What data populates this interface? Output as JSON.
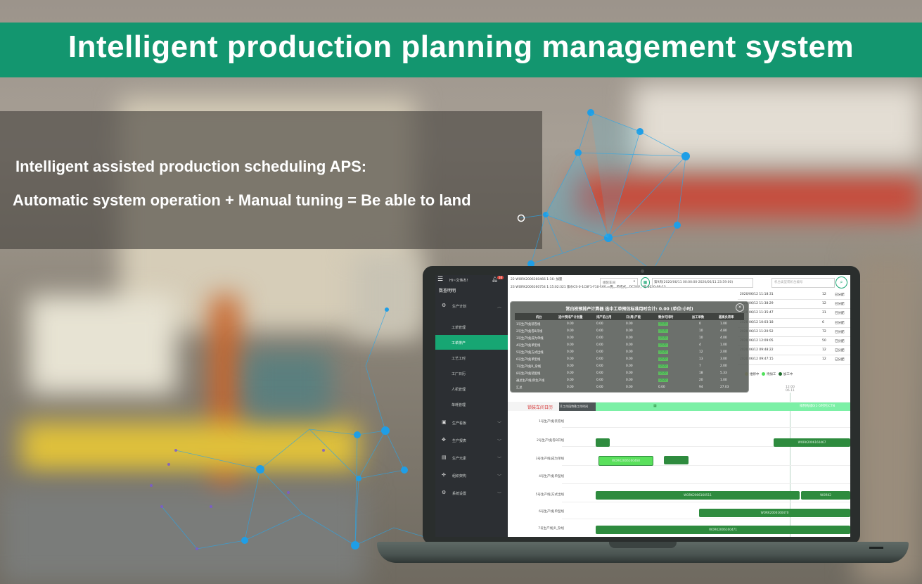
{
  "banner": {
    "title": "Intelligent production planning management system"
  },
  "caption": {
    "line1": "Intelligent assisted production scheduling APS:",
    "line2": "Automatic system operation + Manual tuning = Be able to land"
  },
  "colors": {
    "brand_green": "#13966f",
    "active_green": "#17a673",
    "bar_green": "#2e8b3e",
    "alert_red": "#d63b3b"
  },
  "app": {
    "sidebar": {
      "menu_icon": "menu-collapse-icon",
      "greeting": "Hi~文伟杰!",
      "badge": "16",
      "user": "数查明明",
      "items": [
        {
          "label": "生产计划",
          "icon": "plan-icon",
          "expanded": true
        },
        {
          "label": "生产看板",
          "icon": "board-icon"
        },
        {
          "label": "生产报表",
          "icon": "report-icon"
        },
        {
          "label": "生产元素",
          "icon": "element-icon"
        },
        {
          "label": "组织架构",
          "icon": "org-icon"
        },
        {
          "label": "系统设置",
          "icon": "settings-icon"
        }
      ],
      "subitems": [
        {
          "label": "工单管理",
          "active": false
        },
        {
          "label": "工单排产",
          "active": true
        },
        {
          "label": "工艺工时",
          "active": false
        },
        {
          "label": "工厂日历",
          "active": false
        },
        {
          "label": "人机管理",
          "active": false
        },
        {
          "label": "单耗管理",
          "active": false
        }
      ]
    },
    "topbar": {
      "row1": "22  WORK2006160466  1:16:  加量",
      "row2": "23  WORK2006160754  1:15:02:321     紫巾CS-0-1C8F1-F10-160 一覧，不成式，DC24V，等     2020-06-13",
      "select": "组装车间",
      "range": "第9周(2020/06/11 00:00:00-2020/06/11 23:59:00)",
      "search_placeholder": "机台类型或机台编号",
      "search_icon": "search-icon",
      "calendar_icon": "calendar-icon"
    },
    "right_table": [
      {
        "time": "2020/06/12 11:18:31",
        "qty": "12",
        "status": "已分配"
      },
      {
        "time": "2020/06/12 11:38:29",
        "qty": "12",
        "status": "已分配"
      },
      {
        "time": "2020/06/12 11:35:47",
        "qty": "31",
        "status": "已分配"
      },
      {
        "time": "2020/06/12 10:03:18",
        "qty": "6",
        "status": "已分配"
      },
      {
        "time": "2020/06/12 11:20:52",
        "qty": "72",
        "status": "已分配"
      },
      {
        "time": "2020/06/12 12:09:05",
        "qty": "50",
        "status": "已分配"
      },
      {
        "time": "2020/06/12 09:48:22",
        "qty": "12",
        "status": "已分配"
      },
      {
        "time": "2020/06/12 09:47:15",
        "qty": "12",
        "status": "已分配"
      }
    ],
    "popup": {
      "title": "常白校预排产计算器 选中工单预估标准用时合计: 0.00 (单位:小时)",
      "close_icon": "close-icon",
      "columns": [
        "机台",
        "选中预排产计划量",
        "排产前占用",
        "日(周)产能",
        "剩余可排时",
        "加工单数",
        "最高负荷率"
      ],
      "rows": [
        [
          "1号生产线|装卷线",
          "0.00",
          "0.00",
          "0.00",
          "0.00",
          "0",
          "1.00"
        ],
        [
          "2号生产线|卷B开线",
          "0.00",
          "0.00",
          "0.00",
          "0.00",
          "10",
          "4.80"
        ],
        [
          "3号生产线|成为单线",
          "0.00",
          "0.00",
          "0.00",
          "0.00",
          "10",
          "4.00"
        ],
        [
          "4号生产线|单型线",
          "0.00",
          "0.00",
          "0.00",
          "0.00",
          "4",
          "1.00"
        ],
        [
          "5号生产线|方式出线",
          "0.00",
          "0.00",
          "0.00",
          "0.00",
          "12",
          "2.00"
        ],
        [
          "6号生产线|单型线",
          "0.00",
          "0.00",
          "0.00",
          "0.00",
          "13",
          "3.00"
        ],
        [
          "7号生产线|R_杂线",
          "0.00",
          "0.00",
          "0.00",
          "0.00",
          "7",
          "2.00"
        ],
        [
          "8号生产线|装配线",
          "0.00",
          "0.00",
          "0.00",
          "0.00",
          "18",
          "5.33"
        ],
        [
          "通总生产线|单生产线",
          "0.00",
          "0.00",
          "0.00",
          "0.00",
          "20",
          "1.00"
        ],
        [
          "汇总",
          "0.00",
          "0.00",
          "0.00",
          "0.00",
          "94",
          "27.03"
        ]
      ]
    },
    "legend": [
      {
        "label": "维修中",
        "color": "#e8d94a"
      },
      {
        "label": "待加工",
        "color": "#4fe05a"
      },
      {
        "label": "加工中",
        "color": "#1f6b2c"
      }
    ],
    "time_marker": {
      "line1": "12:00",
      "line2": "06.11"
    },
    "gantt": {
      "title": "锁装车间日历",
      "header_dark": "11工作段特殊工作时间",
      "header_green": "排列构成0(1-5时时)CTN",
      "rows": [
        {
          "label": "1号生产线|装卷线"
        },
        {
          "label": "2号生产线|卷B开线"
        },
        {
          "label": "3号生产线|成为单线"
        },
        {
          "label": "4号生产线|单型线"
        },
        {
          "label": "5号生产线|方式出线"
        },
        {
          "label": "6号生产线|单型线"
        },
        {
          "label": "7号生产线|R_杂线"
        }
      ],
      "bars": [
        {
          "row": 1,
          "label": ""
        },
        {
          "row": 1,
          "label": "WORK2006160467"
        },
        {
          "row": 2,
          "label": "WORK2006160468"
        },
        {
          "row": 2,
          "label": ""
        },
        {
          "row": 4,
          "label": "WORK2006160511"
        },
        {
          "row": 4,
          "label": "WORK2"
        },
        {
          "row": 5,
          "label": "WORK2006160470"
        },
        {
          "row": 6,
          "label": "WORK2006160471"
        }
      ]
    }
  }
}
